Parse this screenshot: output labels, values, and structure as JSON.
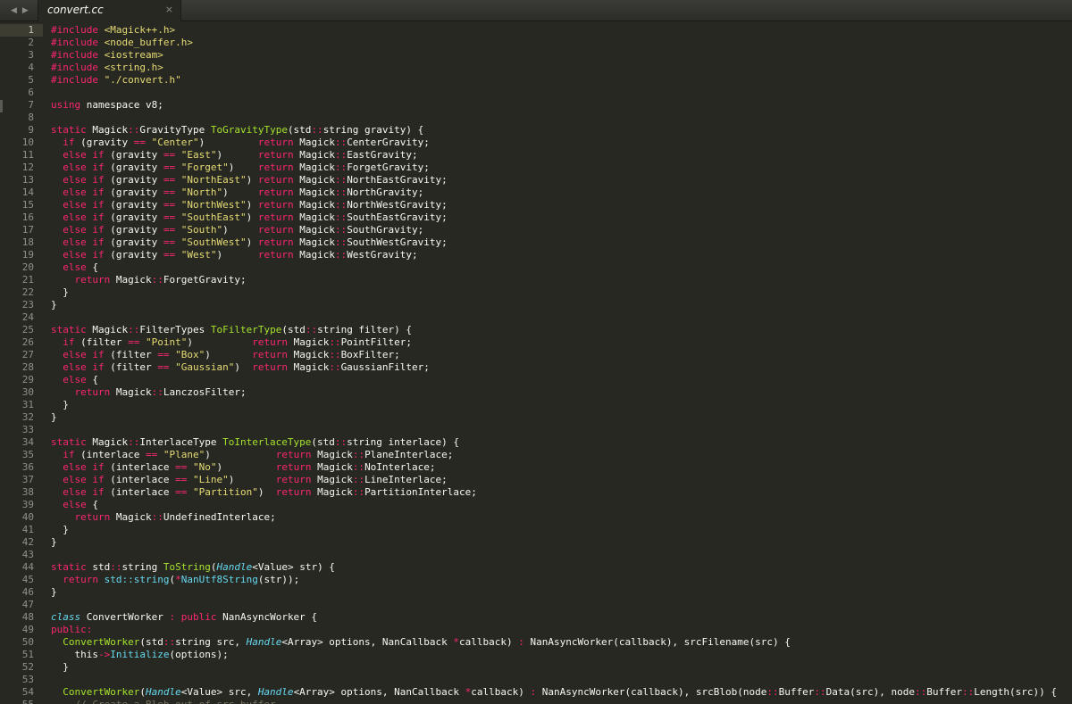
{
  "tab": {
    "title": "convert.cc",
    "close_glyph": "×"
  },
  "nav": {
    "back": "◀",
    "forward": "▶"
  },
  "colors": {
    "background": "#272822",
    "keyword": "#f92672",
    "string": "#e6db74",
    "function": "#a6e22e",
    "type": "#66d9ef",
    "comment": "#75715e",
    "text": "#f8f8f2"
  },
  "editor": {
    "current_line": 1,
    "lines": [
      [
        [
          "k",
          "#include"
        ],
        [
          "p",
          " "
        ],
        [
          "s",
          "<Magick++.h>"
        ]
      ],
      [
        [
          "k",
          "#include"
        ],
        [
          "p",
          " "
        ],
        [
          "s",
          "<node_buffer.h>"
        ]
      ],
      [
        [
          "k",
          "#include"
        ],
        [
          "p",
          " "
        ],
        [
          "s",
          "<iostream>"
        ]
      ],
      [
        [
          "k",
          "#include"
        ],
        [
          "p",
          " "
        ],
        [
          "s",
          "<string.h>"
        ]
      ],
      [
        [
          "k",
          "#include"
        ],
        [
          "p",
          " "
        ],
        [
          "s",
          "\"./convert.h\""
        ]
      ],
      [],
      [
        [
          "k",
          "using"
        ],
        [
          "p",
          " namespace v8;"
        ]
      ],
      [],
      [
        [
          "k",
          "static"
        ],
        [
          "p",
          " Magick"
        ],
        [
          "k",
          "::"
        ],
        [
          "p",
          "GravityType "
        ],
        [
          "f",
          "ToGravityType"
        ],
        [
          "p",
          "(std"
        ],
        [
          "k",
          "::"
        ],
        [
          "p",
          "string gravity) {"
        ]
      ],
      [
        [
          "p",
          "  "
        ],
        [
          "k",
          "if"
        ],
        [
          "p",
          " (gravity "
        ],
        [
          "k",
          "=="
        ],
        [
          "p",
          " "
        ],
        [
          "s",
          "\"Center\""
        ],
        [
          "p",
          ")         "
        ],
        [
          "k",
          "return"
        ],
        [
          "p",
          " Magick"
        ],
        [
          "k",
          "::"
        ],
        [
          "p",
          "CenterGravity;"
        ]
      ],
      [
        [
          "p",
          "  "
        ],
        [
          "k",
          "else if"
        ],
        [
          "p",
          " (gravity "
        ],
        [
          "k",
          "=="
        ],
        [
          "p",
          " "
        ],
        [
          "s",
          "\"East\""
        ],
        [
          "p",
          ")      "
        ],
        [
          "k",
          "return"
        ],
        [
          "p",
          " Magick"
        ],
        [
          "k",
          "::"
        ],
        [
          "p",
          "EastGravity;"
        ]
      ],
      [
        [
          "p",
          "  "
        ],
        [
          "k",
          "else if"
        ],
        [
          "p",
          " (gravity "
        ],
        [
          "k",
          "=="
        ],
        [
          "p",
          " "
        ],
        [
          "s",
          "\"Forget\""
        ],
        [
          "p",
          ")    "
        ],
        [
          "k",
          "return"
        ],
        [
          "p",
          " Magick"
        ],
        [
          "k",
          "::"
        ],
        [
          "p",
          "ForgetGravity;"
        ]
      ],
      [
        [
          "p",
          "  "
        ],
        [
          "k",
          "else if"
        ],
        [
          "p",
          " (gravity "
        ],
        [
          "k",
          "=="
        ],
        [
          "p",
          " "
        ],
        [
          "s",
          "\"NorthEast\""
        ],
        [
          "p",
          ") "
        ],
        [
          "k",
          "return"
        ],
        [
          "p",
          " Magick"
        ],
        [
          "k",
          "::"
        ],
        [
          "p",
          "NorthEastGravity;"
        ]
      ],
      [
        [
          "p",
          "  "
        ],
        [
          "k",
          "else if"
        ],
        [
          "p",
          " (gravity "
        ],
        [
          "k",
          "=="
        ],
        [
          "p",
          " "
        ],
        [
          "s",
          "\"North\""
        ],
        [
          "p",
          ")     "
        ],
        [
          "k",
          "return"
        ],
        [
          "p",
          " Magick"
        ],
        [
          "k",
          "::"
        ],
        [
          "p",
          "NorthGravity;"
        ]
      ],
      [
        [
          "p",
          "  "
        ],
        [
          "k",
          "else if"
        ],
        [
          "p",
          " (gravity "
        ],
        [
          "k",
          "=="
        ],
        [
          "p",
          " "
        ],
        [
          "s",
          "\"NorthWest\""
        ],
        [
          "p",
          ") "
        ],
        [
          "k",
          "return"
        ],
        [
          "p",
          " Magick"
        ],
        [
          "k",
          "::"
        ],
        [
          "p",
          "NorthWestGravity;"
        ]
      ],
      [
        [
          "p",
          "  "
        ],
        [
          "k",
          "else if"
        ],
        [
          "p",
          " (gravity "
        ],
        [
          "k",
          "=="
        ],
        [
          "p",
          " "
        ],
        [
          "s",
          "\"SouthEast\""
        ],
        [
          "p",
          ") "
        ],
        [
          "k",
          "return"
        ],
        [
          "p",
          " Magick"
        ],
        [
          "k",
          "::"
        ],
        [
          "p",
          "SouthEastGravity;"
        ]
      ],
      [
        [
          "p",
          "  "
        ],
        [
          "k",
          "else if"
        ],
        [
          "p",
          " (gravity "
        ],
        [
          "k",
          "=="
        ],
        [
          "p",
          " "
        ],
        [
          "s",
          "\"South\""
        ],
        [
          "p",
          ")     "
        ],
        [
          "k",
          "return"
        ],
        [
          "p",
          " Magick"
        ],
        [
          "k",
          "::"
        ],
        [
          "p",
          "SouthGravity;"
        ]
      ],
      [
        [
          "p",
          "  "
        ],
        [
          "k",
          "else if"
        ],
        [
          "p",
          " (gravity "
        ],
        [
          "k",
          "=="
        ],
        [
          "p",
          " "
        ],
        [
          "s",
          "\"SouthWest\""
        ],
        [
          "p",
          ") "
        ],
        [
          "k",
          "return"
        ],
        [
          "p",
          " Magick"
        ],
        [
          "k",
          "::"
        ],
        [
          "p",
          "SouthWestGravity;"
        ]
      ],
      [
        [
          "p",
          "  "
        ],
        [
          "k",
          "else if"
        ],
        [
          "p",
          " (gravity "
        ],
        [
          "k",
          "=="
        ],
        [
          "p",
          " "
        ],
        [
          "s",
          "\"West\""
        ],
        [
          "p",
          ")      "
        ],
        [
          "k",
          "return"
        ],
        [
          "p",
          " Magick"
        ],
        [
          "k",
          "::"
        ],
        [
          "p",
          "WestGravity;"
        ]
      ],
      [
        [
          "p",
          "  "
        ],
        [
          "k",
          "else"
        ],
        [
          "p",
          " {"
        ]
      ],
      [
        [
          "p",
          "    "
        ],
        [
          "k",
          "return"
        ],
        [
          "p",
          " Magick"
        ],
        [
          "k",
          "::"
        ],
        [
          "p",
          "ForgetGravity;"
        ]
      ],
      [
        [
          "p",
          "  }"
        ]
      ],
      [
        [
          "p",
          "}"
        ]
      ],
      [],
      [
        [
          "k",
          "static"
        ],
        [
          "p",
          " Magick"
        ],
        [
          "k",
          "::"
        ],
        [
          "p",
          "FilterTypes "
        ],
        [
          "f",
          "ToFilterType"
        ],
        [
          "p",
          "(std"
        ],
        [
          "k",
          "::"
        ],
        [
          "p",
          "string filter) {"
        ]
      ],
      [
        [
          "p",
          "  "
        ],
        [
          "k",
          "if"
        ],
        [
          "p",
          " (filter "
        ],
        [
          "k",
          "=="
        ],
        [
          "p",
          " "
        ],
        [
          "s",
          "\"Point\""
        ],
        [
          "p",
          ")          "
        ],
        [
          "k",
          "return"
        ],
        [
          "p",
          " Magick"
        ],
        [
          "k",
          "::"
        ],
        [
          "p",
          "PointFilter;"
        ]
      ],
      [
        [
          "p",
          "  "
        ],
        [
          "k",
          "else if"
        ],
        [
          "p",
          " (filter "
        ],
        [
          "k",
          "=="
        ],
        [
          "p",
          " "
        ],
        [
          "s",
          "\"Box\""
        ],
        [
          "p",
          ")       "
        ],
        [
          "k",
          "return"
        ],
        [
          "p",
          " Magick"
        ],
        [
          "k",
          "::"
        ],
        [
          "p",
          "BoxFilter;"
        ]
      ],
      [
        [
          "p",
          "  "
        ],
        [
          "k",
          "else if"
        ],
        [
          "p",
          " (filter "
        ],
        [
          "k",
          "=="
        ],
        [
          "p",
          " "
        ],
        [
          "s",
          "\"Gaussian\""
        ],
        [
          "p",
          ")  "
        ],
        [
          "k",
          "return"
        ],
        [
          "p",
          " Magick"
        ],
        [
          "k",
          "::"
        ],
        [
          "p",
          "GaussianFilter;"
        ]
      ],
      [
        [
          "p",
          "  "
        ],
        [
          "k",
          "else"
        ],
        [
          "p",
          " {"
        ]
      ],
      [
        [
          "p",
          "    "
        ],
        [
          "k",
          "return"
        ],
        [
          "p",
          " Magick"
        ],
        [
          "k",
          "::"
        ],
        [
          "p",
          "LanczosFilter;"
        ]
      ],
      [
        [
          "p",
          "  }"
        ]
      ],
      [
        [
          "p",
          "}"
        ]
      ],
      [],
      [
        [
          "k",
          "static"
        ],
        [
          "p",
          " Magick"
        ],
        [
          "k",
          "::"
        ],
        [
          "p",
          "InterlaceType "
        ],
        [
          "f",
          "ToInterlaceType"
        ],
        [
          "p",
          "(std"
        ],
        [
          "k",
          "::"
        ],
        [
          "p",
          "string interlace) {"
        ]
      ],
      [
        [
          "p",
          "  "
        ],
        [
          "k",
          "if"
        ],
        [
          "p",
          " (interlace "
        ],
        [
          "k",
          "=="
        ],
        [
          "p",
          " "
        ],
        [
          "s",
          "\"Plane\""
        ],
        [
          "p",
          ")           "
        ],
        [
          "k",
          "return"
        ],
        [
          "p",
          " Magick"
        ],
        [
          "k",
          "::"
        ],
        [
          "p",
          "PlaneInterlace;"
        ]
      ],
      [
        [
          "p",
          "  "
        ],
        [
          "k",
          "else if"
        ],
        [
          "p",
          " (interlace "
        ],
        [
          "k",
          "=="
        ],
        [
          "p",
          " "
        ],
        [
          "s",
          "\"No\""
        ],
        [
          "p",
          ")         "
        ],
        [
          "k",
          "return"
        ],
        [
          "p",
          " Magick"
        ],
        [
          "k",
          "::"
        ],
        [
          "p",
          "NoInterlace;"
        ]
      ],
      [
        [
          "p",
          "  "
        ],
        [
          "k",
          "else if"
        ],
        [
          "p",
          " (interlace "
        ],
        [
          "k",
          "=="
        ],
        [
          "p",
          " "
        ],
        [
          "s",
          "\"Line\""
        ],
        [
          "p",
          ")       "
        ],
        [
          "k",
          "return"
        ],
        [
          "p",
          " Magick"
        ],
        [
          "k",
          "::"
        ],
        [
          "p",
          "LineInterlace;"
        ]
      ],
      [
        [
          "p",
          "  "
        ],
        [
          "k",
          "else if"
        ],
        [
          "p",
          " (interlace "
        ],
        [
          "k",
          "=="
        ],
        [
          "p",
          " "
        ],
        [
          "s",
          "\"Partition\""
        ],
        [
          "p",
          ")  "
        ],
        [
          "k",
          "return"
        ],
        [
          "p",
          " Magick"
        ],
        [
          "k",
          "::"
        ],
        [
          "p",
          "PartitionInterlace;"
        ]
      ],
      [
        [
          "p",
          "  "
        ],
        [
          "k",
          "else"
        ],
        [
          "p",
          " {"
        ]
      ],
      [
        [
          "p",
          "    "
        ],
        [
          "k",
          "return"
        ],
        [
          "p",
          " Magick"
        ],
        [
          "k",
          "::"
        ],
        [
          "p",
          "UndefinedInterlace;"
        ]
      ],
      [
        [
          "p",
          "  }"
        ]
      ],
      [
        [
          "p",
          "}"
        ]
      ],
      [],
      [
        [
          "k",
          "static"
        ],
        [
          "p",
          " std"
        ],
        [
          "k",
          "::"
        ],
        [
          "p",
          "string "
        ],
        [
          "f",
          "ToString"
        ],
        [
          "p",
          "("
        ],
        [
          "ti",
          "Handle"
        ],
        [
          "p",
          "<Value> str) {"
        ]
      ],
      [
        [
          "p",
          "  "
        ],
        [
          "k",
          "return"
        ],
        [
          "p",
          " "
        ],
        [
          "t",
          "std::string"
        ],
        [
          "p",
          "("
        ],
        [
          "k",
          "*"
        ],
        [
          "t",
          "NanUtf8String"
        ],
        [
          "p",
          "(str));"
        ]
      ],
      [
        [
          "p",
          "}"
        ]
      ],
      [],
      [
        [
          "ti",
          "class"
        ],
        [
          "p",
          " ConvertWorker "
        ],
        [
          "k",
          ":"
        ],
        [
          "p",
          " "
        ],
        [
          "k",
          "public"
        ],
        [
          "p",
          " NanAsyncWorker {"
        ]
      ],
      [
        [
          "k",
          "public:"
        ]
      ],
      [
        [
          "p",
          "  "
        ],
        [
          "f",
          "ConvertWorker"
        ],
        [
          "p",
          "(std"
        ],
        [
          "k",
          "::"
        ],
        [
          "p",
          "string src, "
        ],
        [
          "ti",
          "Handle"
        ],
        [
          "p",
          "<Array> options, NanCallback "
        ],
        [
          "k",
          "*"
        ],
        [
          "p",
          "callback) "
        ],
        [
          "k",
          ":"
        ],
        [
          "p",
          " NanAsyncWorker(callback), srcFilename(src) {"
        ]
      ],
      [
        [
          "p",
          "    this"
        ],
        [
          "k",
          "->"
        ],
        [
          "t",
          "Initialize"
        ],
        [
          "p",
          "(options);"
        ]
      ],
      [
        [
          "p",
          "  }"
        ]
      ],
      [],
      [
        [
          "p",
          "  "
        ],
        [
          "f",
          "ConvertWorker"
        ],
        [
          "p",
          "("
        ],
        [
          "ti",
          "Handle"
        ],
        [
          "p",
          "<Value> src, "
        ],
        [
          "ti",
          "Handle"
        ],
        [
          "p",
          "<Array> options, NanCallback "
        ],
        [
          "k",
          "*"
        ],
        [
          "p",
          "callback) "
        ],
        [
          "k",
          ":"
        ],
        [
          "p",
          " NanAsyncWorker(callback), srcBlob(node"
        ],
        [
          "k",
          "::"
        ],
        [
          "p",
          "Buffer"
        ],
        [
          "k",
          "::"
        ],
        [
          "p",
          "Data(src), node"
        ],
        [
          "k",
          "::"
        ],
        [
          "p",
          "Buffer"
        ],
        [
          "k",
          "::"
        ],
        [
          "p",
          "Length(src)) {"
        ]
      ],
      [
        [
          "p",
          "    "
        ],
        [
          "c",
          "// Create a Blob out of src buffer"
        ]
      ]
    ]
  }
}
